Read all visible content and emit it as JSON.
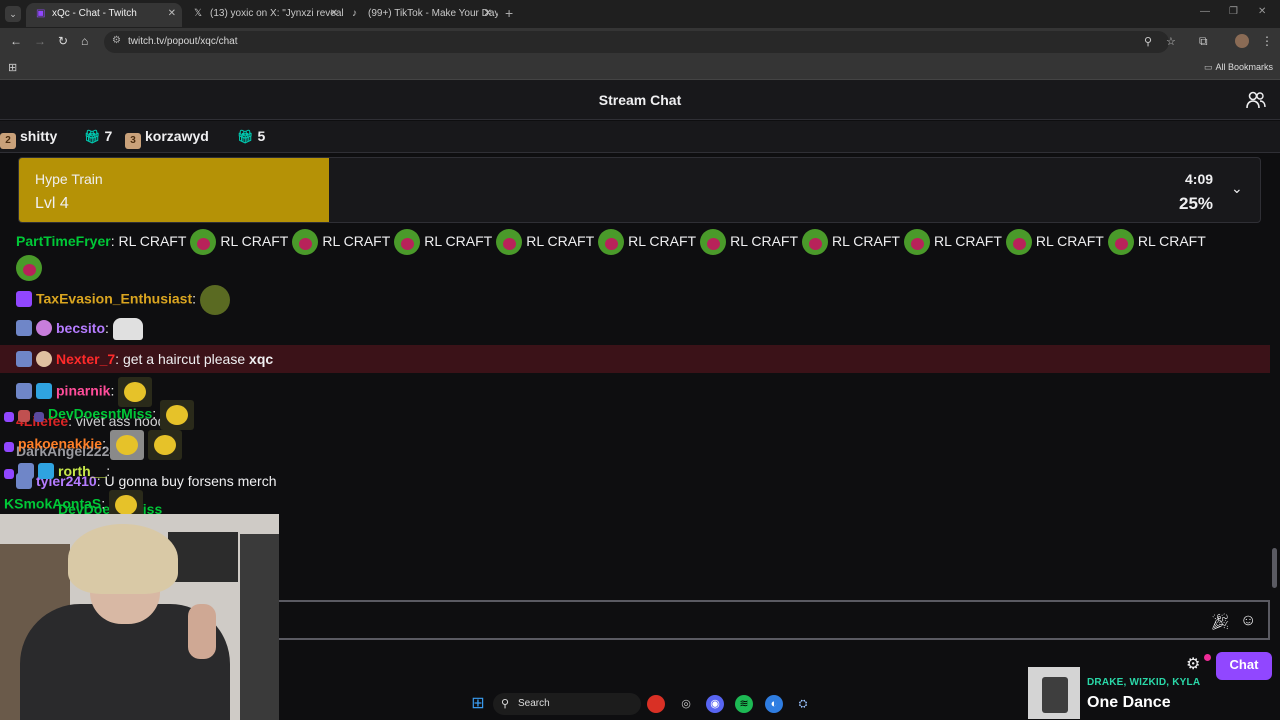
{
  "browser": {
    "tabs": [
      {
        "title": "xQc - Chat - Twitch",
        "favicon": "twitch-icon"
      },
      {
        "title": "(13) yoxic on X: \"Jynxzi reveals",
        "favicon": "x-icon"
      },
      {
        "title": "(99+) TikTok - Make Your Day",
        "favicon": "tiktok-icon"
      }
    ],
    "url": "twitch.tv/popout/xqc/chat",
    "all_bookmarks": "All Bookmarks"
  },
  "chat": {
    "title": "Stream Chat",
    "leaderboard": [
      {
        "rank": "2",
        "name": "shitty"
      },
      {
        "gifts": "7"
      },
      {
        "rank": "3",
        "name": "korzawyd"
      },
      {
        "gifts": "5"
      }
    ],
    "hype_train": {
      "title": "Hype Train",
      "level": "Lvl 4",
      "time": "4:09",
      "percent": "25%",
      "progress": 0.25,
      "color": "#b59206"
    },
    "messages": {
      "m1_user": "PartTimeFryer",
      "m1_text": "RL CRAFT",
      "m2_user": "TaxEvasion_Enthusiast",
      "m3_user": "becsito",
      "m4_user": "Nexter_7",
      "m4_text": "get a haircut please",
      "m4_mention": "xqc",
      "m5_user": "pinarnik",
      "m6_user": "DevDoesntMiss",
      "m6_hidden_user": "4Lilefee",
      "m6_hidden_text": "vivet ass noodle",
      "m7_user": "pakoenakkie",
      "m7_hidden_user": "DarkAngel2224",
      "m8_user": "rorth__",
      "m8_hidden_user": "tyler2410",
      "m8_text": "U gonna buy forsens merch",
      "m9_user": "SmokAontaS",
      "m9_hidden_user": "DevDoesntMiss"
    },
    "input": {
      "placeholder": ""
    },
    "chat_button": "Chat"
  },
  "taskbar": {
    "search_label": "Search"
  },
  "now_playing": {
    "artist": "DRAKE, WIZKID, KYLA",
    "title": "One Dance"
  },
  "colors": {
    "twitch_purple": "#9147ff",
    "hype_gold": "#b59206",
    "user_green": "#00c837",
    "user_gold": "#daa520",
    "user_purple": "#b57cff",
    "user_red": "#ff2a2a",
    "user_pink": "#ff4d9a",
    "user_orange": "#ff7f27"
  }
}
